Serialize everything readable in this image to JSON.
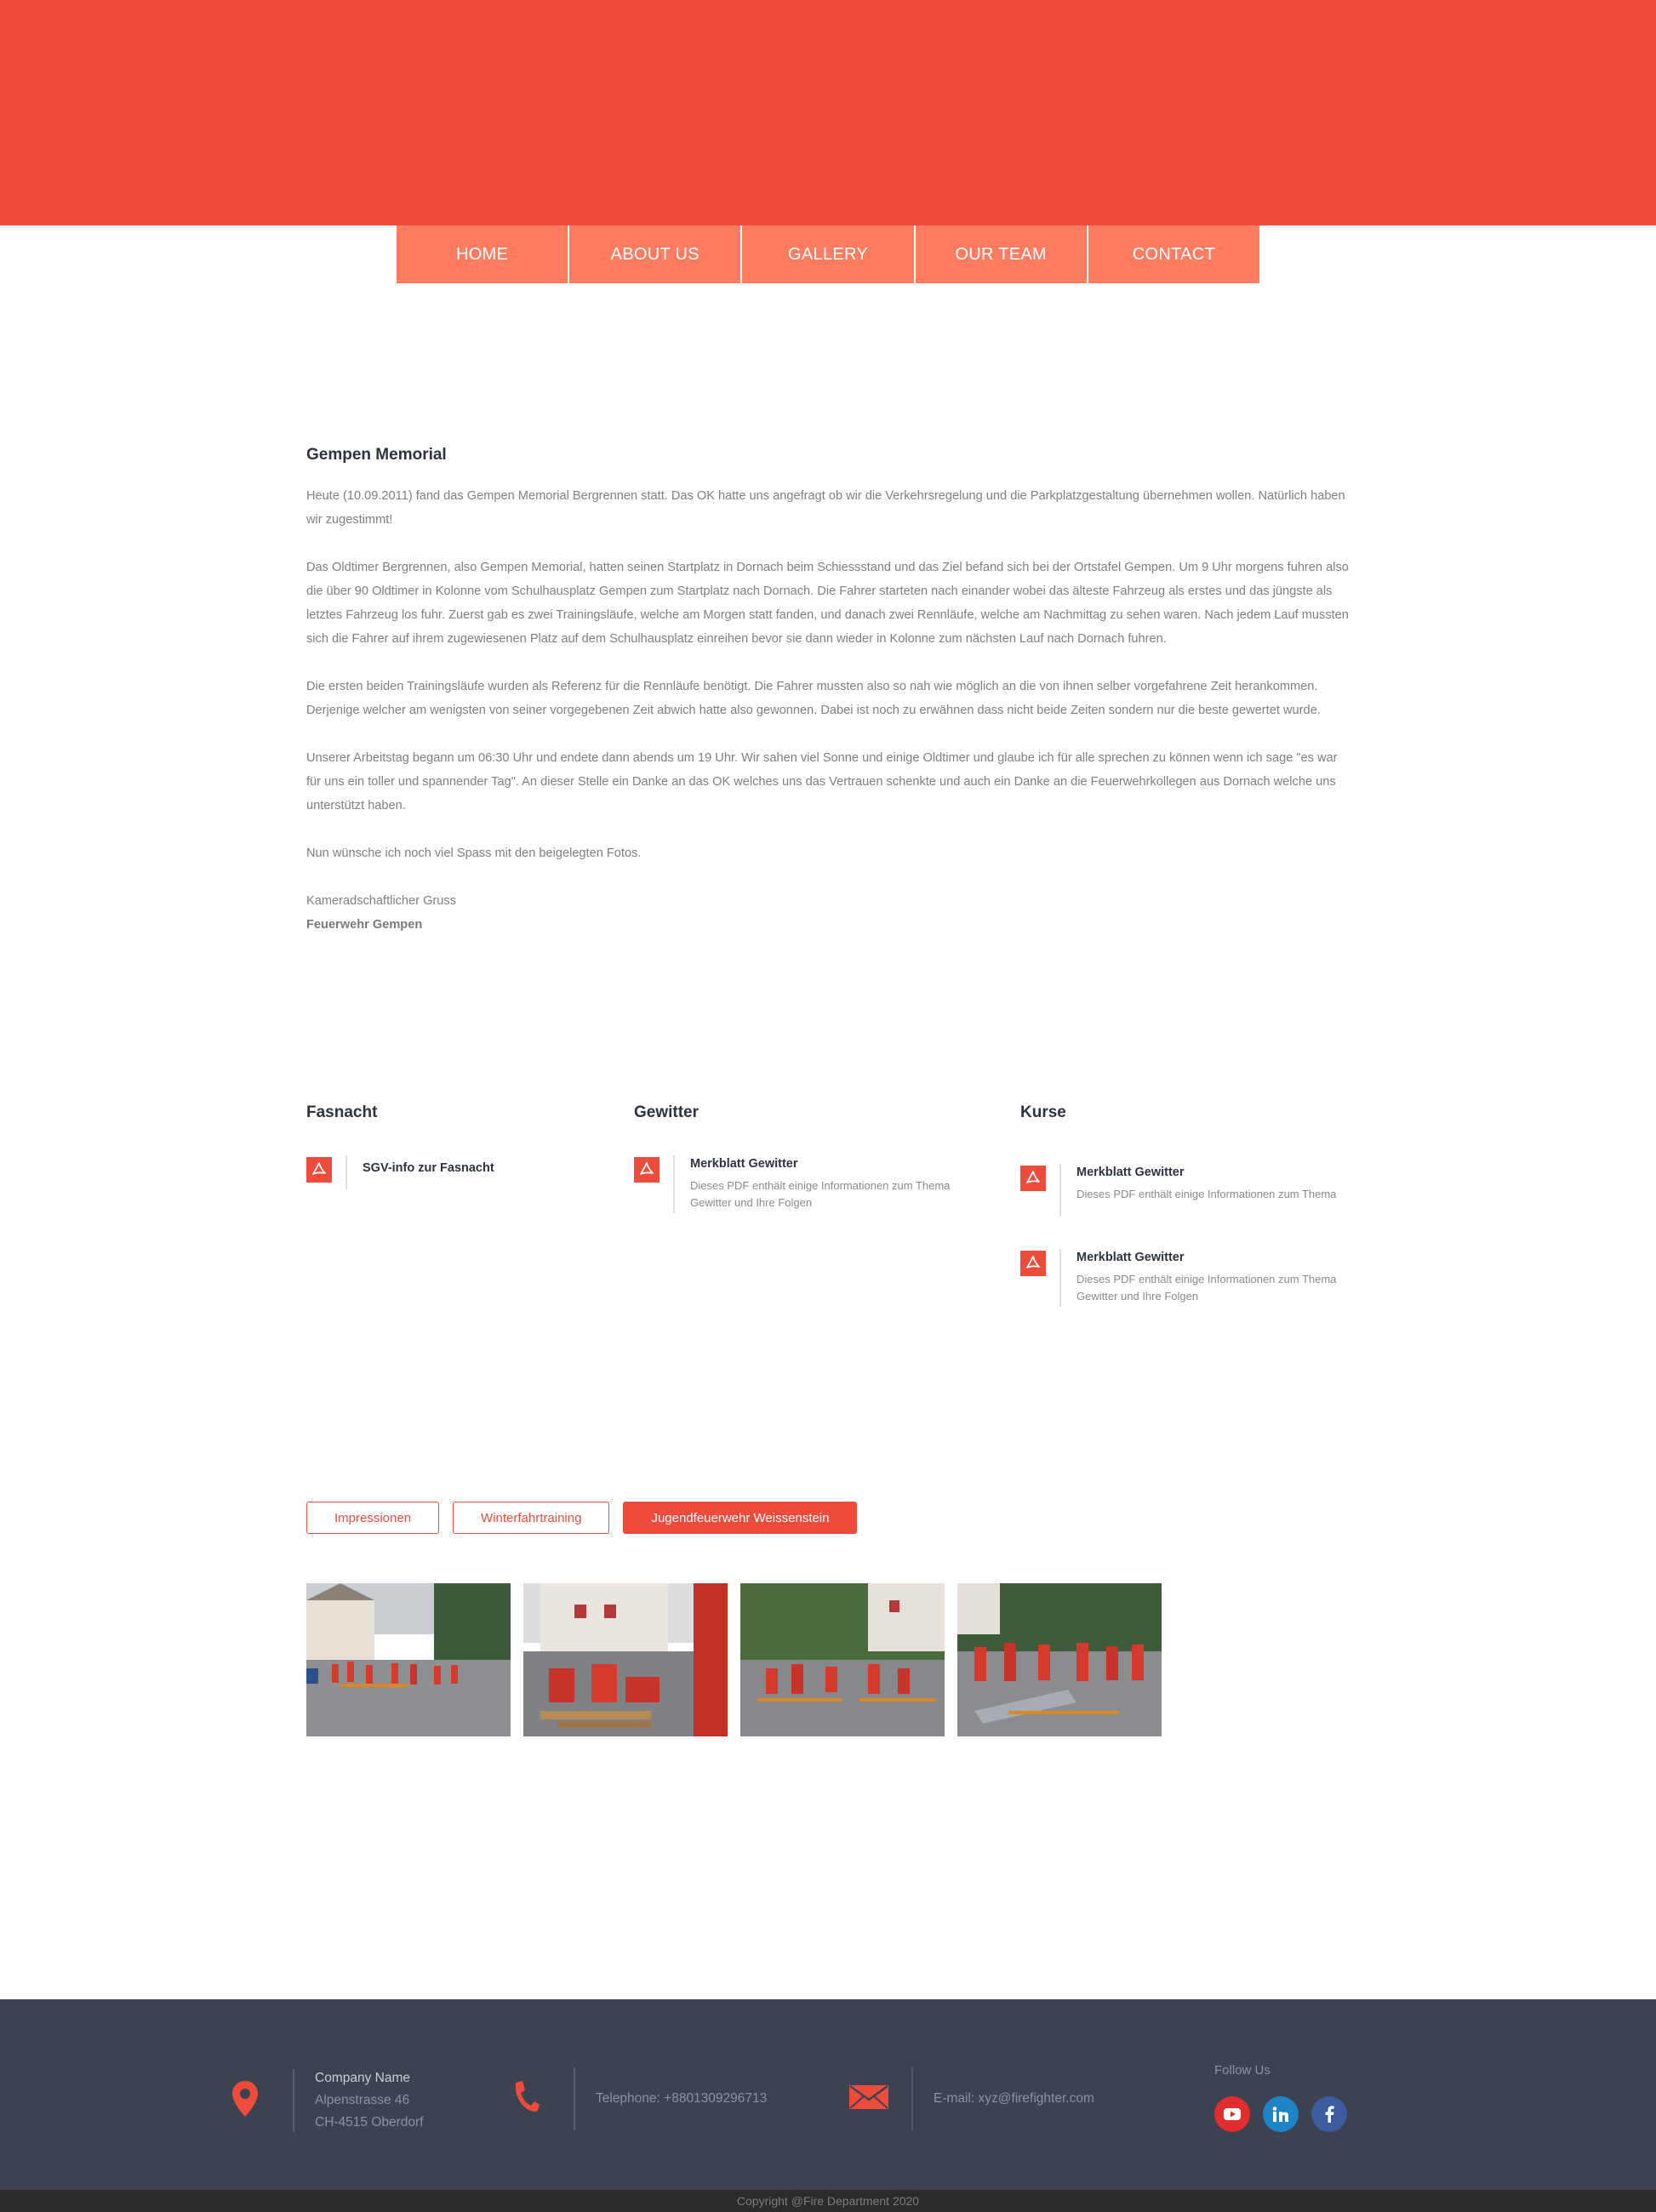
{
  "nav": {
    "items": [
      "HOME",
      "ABOUT US",
      "GALLERY",
      "OUR TEAM",
      "CONTACT"
    ]
  },
  "article": {
    "title": "Gempen Memorial",
    "paragraphs": [
      "Heute (10.09.2011) fand das Gempen Memorial Bergrennen statt. Das OK hatte uns angefragt ob wir die Verkehrsregelung und die Parkplatzgestaltung übernehmen wollen. Natürlich haben wir zugestimmt!",
      "Das Oldtimer Bergrennen, also Gempen Memorial, hatten seinen Startplatz in Dornach beim Schiessstand und das Ziel befand sich bei der Ortstafel Gempen. Um 9 Uhr morgens fuhren also die über 90 Oldtimer in Kolonne vom Schulhausplatz Gempen zum Startplatz nach Dornach. Die Fahrer starteten nach einander wobei das älteste Fahrzeug als erstes und das jüngste als letztes Fahrzeug los fuhr. Zuerst gab es zwei Trainingsläufe, welche am Morgen statt fanden, und danach zwei Rennläufe, welche am Nachmittag zu sehen waren. Nach jedem Lauf mussten sich die Fahrer auf ihrem zugewiesenen Platz auf dem Schulhausplatz einreihen bevor sie dann wieder in Kolonne zum nächsten Lauf nach Dornach fuhren.",
      "Die ersten beiden Trainingsläufe wurden als Referenz für die Rennläufe benötigt. Die Fahrer mussten also so nah wie möglich an die von ihnen selber vorgefahrene Zeit herankommen. Derjenige welcher am wenigsten von seiner vorgegebenen Zeit abwich hatte also gewonnen. Dabei ist noch zu erwähnen dass nicht beide Zeiten sondern nur die beste gewertet wurde.",
      "Unserer Arbeitstag begann um 06:30 Uhr und endete dann abends um 19 Uhr. Wir sahen viel Sonne und einige Oldtimer und glaube ich für alle sprechen zu können wenn ich sage \"es war für uns ein toller und spannender Tag\". An dieser Stelle ein Danke an das OK welches uns das Vertrauen schenkte und auch ein Danke an die Feuerwehrkollegen aus Dornach welche uns unterstützt haben.",
      "Nun wünsche ich noch viel Spass mit den beigelegten Fotos."
    ],
    "greeting": "Kameradschaftlicher Gruss",
    "signature": "Feuerwehr Gempen"
  },
  "downloads": [
    {
      "heading": "Fasnacht",
      "items": [
        {
          "title": "SGV-info zur Fasnacht",
          "desc": ""
        }
      ]
    },
    {
      "heading": "Gewitter",
      "items": [
        {
          "title": "Merkblatt Gewitter",
          "desc": "Dieses PDF enthält einige Informationen zum Thema Gewitter und Ihre Folgen"
        }
      ]
    },
    {
      "heading": "Kurse",
      "items": [
        {
          "title": "Merkblatt Gewitter",
          "desc": "Dieses PDF enthält einige Informationen zum Thema"
        },
        {
          "title": "Merkblatt Gewitter",
          "desc": "Dieses PDF enthält einige Informationen zum Thema Gewitter und Ihre Folgen"
        }
      ]
    }
  ],
  "gallery": {
    "filters": [
      {
        "label": "Impressionen",
        "active": false
      },
      {
        "label": "Winterfahrtraining",
        "active": false
      },
      {
        "label": "Jugendfeuerwehr Weissenstein",
        "active": true
      }
    ],
    "photo_count": 4
  },
  "footer": {
    "company_name": "Company Name",
    "address_line1": "Alpenstrasse 46",
    "address_line2": "CH-4515 Oberdorf",
    "telephone": "Telephone: +8801309296713",
    "email": "E-mail: xyz@firefighter.com",
    "follow_label": "Follow Us",
    "socials": [
      "youtube-icon",
      "linkedin-icon",
      "facebook-icon"
    ]
  },
  "copyright": "Copyright @Fire Department 2020",
  "colors": {
    "accent": "#ed4c3c",
    "nav": "#ff7c61",
    "footer": "#3c4250",
    "copyright_bar": "#2b2b2b"
  }
}
